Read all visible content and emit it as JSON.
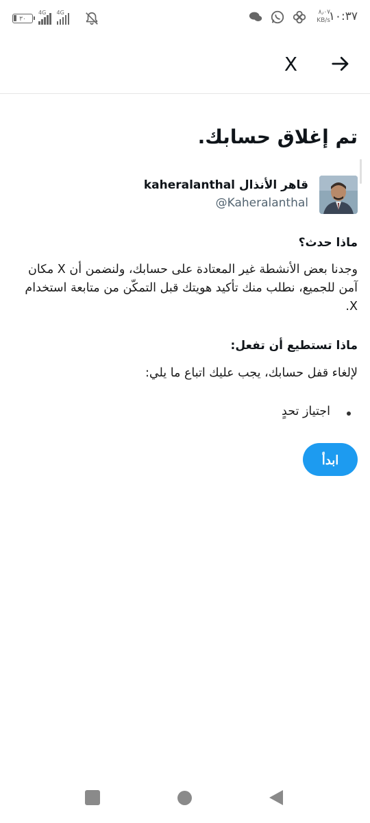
{
  "status_bar": {
    "time": "١٠:٣٧",
    "net_speed": "٨٫٠٧",
    "net_unit": "KB/s",
    "battery": "٣٠",
    "signal_labels": [
      "4G",
      "4G"
    ]
  },
  "header": {
    "logo": "X",
    "back_icon": "arrow-right-icon"
  },
  "page": {
    "title": "تم إغلاق حسابك.",
    "account": {
      "name": "قاهر الأنذال kaheralanthal",
      "handle": "@Kaheralanthal"
    },
    "what_happened_heading": "ماذا حدث؟",
    "what_happened_text": "وجدنا بعض الأنشطة غير المعتادة على حسابك، ولنضمن أن X مكان آمن للجميع، نطلب منك تأكيد هويتك قبل التمكّن من متابعة استخدام X.",
    "what_to_do_heading": "ماذا تستطيع أن تفعل:",
    "what_to_do_text": "لإلغاء قفل حسابك، يجب عليك اتباع ما يلي:",
    "steps": [
      "اجتياز تحدٍ"
    ],
    "start_button": "ابدأ"
  },
  "nav_bar": {
    "icons": [
      "recent-apps-icon",
      "home-icon",
      "back-icon"
    ]
  }
}
